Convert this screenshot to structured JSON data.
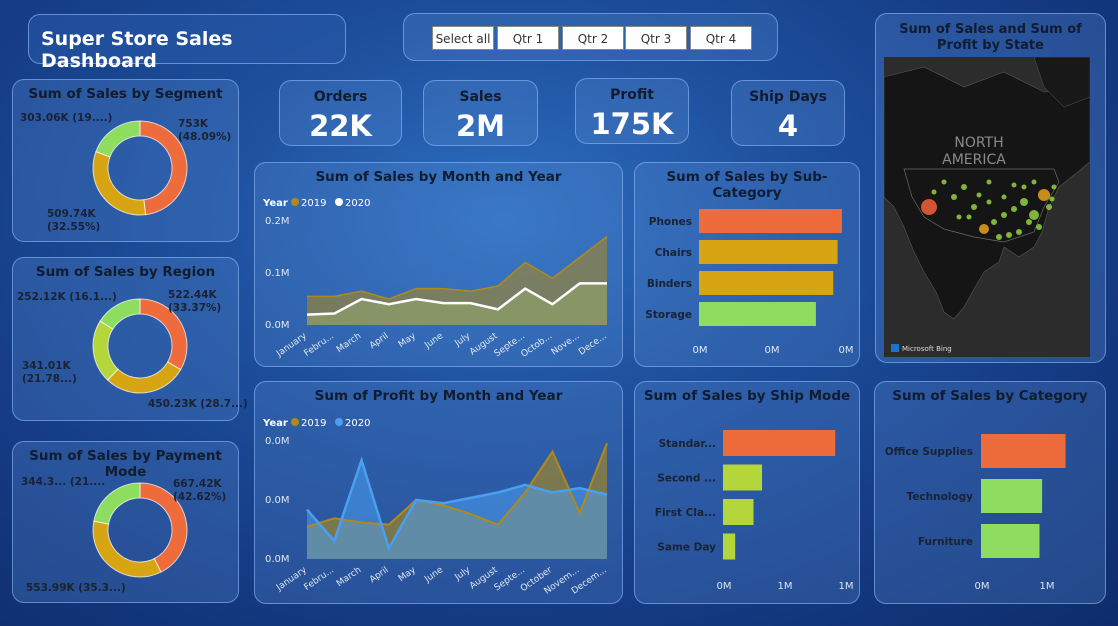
{
  "header": {
    "title": "Super Store Sales Dashboard"
  },
  "slicer": {
    "buttons": [
      "Select all",
      "Qtr 1",
      "Qtr 2",
      "Qtr 3",
      "Qtr 4"
    ]
  },
  "kpis": [
    {
      "label": "Orders",
      "value": "22K"
    },
    {
      "label": "Sales",
      "value": "2M"
    },
    {
      "label": "Profit",
      "value": "175K"
    },
    {
      "label": "Ship Days",
      "value": "4"
    }
  ],
  "colors": {
    "orange": "#ee6b3b",
    "gold": "#d7a514",
    "lightgreen": "#8edc60",
    "yellowgreen": "#b5d63a",
    "blue": "#4a9ff0",
    "olive": "#b08a18"
  },
  "segment": {
    "title": "Sum of Sales by Segment",
    "labels": [
      "753K\n(48.09%)",
      "509.74K\n(32.55%)",
      "303.06K (19....)"
    ],
    "chart_data": {
      "type": "pie",
      "title": "Sum of Sales by Segment",
      "values": [
        753,
        509.74,
        303.06
      ],
      "percent": [
        48.09,
        32.55,
        19.36
      ]
    }
  },
  "region": {
    "title": "Sum of Sales by Region",
    "labels": [
      "522.44K\n(33.37%)",
      "450.23K (28.7...)",
      "341.01K\n(21.78...)",
      "252.12K (16.1...)"
    ],
    "chart_data": {
      "type": "pie",
      "title": "Sum of Sales by Region",
      "values": [
        522.44,
        450.23,
        341.01,
        252.12
      ],
      "percent": [
        33.37,
        28.75,
        21.78,
        16.1
      ]
    }
  },
  "payment": {
    "title": "Sum of Sales by Payment Mode",
    "labels": [
      "667.42K\n(42.62%)",
      "553.99K (35.3...)",
      "344.3... (21...."
    ],
    "chart_data": {
      "type": "pie",
      "title": "Sum of Sales by Payment Mode",
      "values": [
        667.42,
        553.99,
        344.3
      ],
      "percent": [
        42.62,
        35.38,
        21.99
      ]
    }
  },
  "sales_month": {
    "title": "Sum of Sales by Month and Year",
    "legend_title": "Year",
    "chart_data": {
      "type": "area",
      "title": "Sum of Sales by Month and Year",
      "categories": [
        "January",
        "Febru...",
        "March",
        "April",
        "May",
        "June",
        "July",
        "August",
        "Septe...",
        "Octob...",
        "Nove...",
        "Dece..."
      ],
      "series": [
        {
          "name": "2019",
          "values": [
            0.055,
            0.055,
            0.065,
            0.05,
            0.07,
            0.07,
            0.065,
            0.075,
            0.12,
            0.09,
            0.13,
            0.17
          ]
        },
        {
          "name": "2020",
          "values": [
            0.02,
            0.022,
            0.05,
            0.04,
            0.05,
            0.042,
            0.042,
            0.03,
            0.07,
            0.04,
            0.08,
            0.08
          ]
        }
      ],
      "yticks": [
        "0.0M",
        "0.1M",
        "0.2M"
      ],
      "ylim": [
        0,
        0.2
      ]
    }
  },
  "profit_month": {
    "title": "Sum of Profit by Month and Year",
    "legend_title": "Year",
    "chart_data": {
      "type": "area",
      "title": "Sum of Profit by Month and Year",
      "categories": [
        "January",
        "Febru...",
        "March",
        "April",
        "May",
        "June",
        "July",
        "August",
        "Septe...",
        "October",
        "Novem...",
        "Decem..."
      ],
      "series": [
        {
          "name": "2019",
          "values": [
            0.3,
            0.38,
            0.34,
            0.32,
            0.55,
            0.5,
            0.42,
            0.32,
            0.62,
            1.0,
            0.43,
            1.08
          ]
        },
        {
          "name": "2020",
          "values": [
            0.46,
            0.17,
            0.92,
            0.1,
            0.55,
            0.52,
            0.57,
            0.62,
            0.69,
            0.62,
            0.66,
            0.6
          ]
        }
      ],
      "yticks": [
        "0.0M",
        "0.0M",
        "0.0M"
      ]
    }
  },
  "subcategory": {
    "title": "Sum of Sales by Sub-Category",
    "chart_data": {
      "type": "bar",
      "title": "Sum of Sales by Sub-Category",
      "categories": [
        "Phones",
        "Chairs",
        "Binders",
        "Storage"
      ],
      "values": [
        0.33,
        0.32,
        0.31,
        0.27
      ],
      "xticks": [
        "0M",
        "0M",
        "0M"
      ]
    }
  },
  "shipmode": {
    "title": "Sum of Sales by Ship Mode",
    "chart_data": {
      "type": "bar",
      "title": "Sum of Sales by Ship Mode",
      "categories": [
        "Standar...",
        "Second ...",
        "First Cla...",
        "Same Day"
      ],
      "values": [
        0.92,
        0.32,
        0.25,
        0.1
      ],
      "xticks": [
        "0M",
        "1M",
        "1M"
      ]
    }
  },
  "category": {
    "title": "Sum of Sales by Category",
    "chart_data": {
      "type": "bar",
      "title": "Sum of Sales by Category",
      "categories": [
        "Office Supplies",
        "Technology",
        "Furniture"
      ],
      "values": [
        0.65,
        0.47,
        0.45
      ],
      "xticks": [
        "0M",
        "1M"
      ]
    }
  },
  "map": {
    "title": "Sum of Sales and Sum of Profit by State",
    "continent_label_1": "NORTH",
    "continent_label_2": "AMERICA",
    "credit": "Microsoft Bing"
  }
}
